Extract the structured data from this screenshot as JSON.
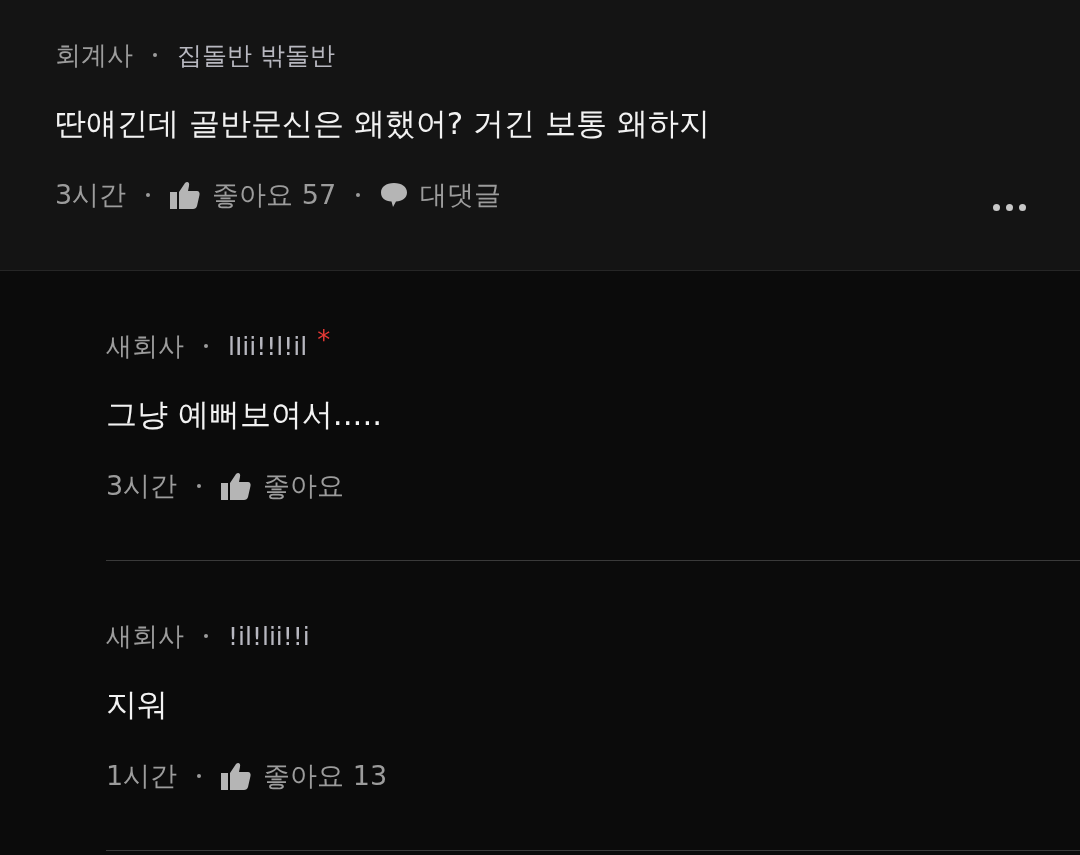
{
  "comment": {
    "company": "회계사",
    "nickname": "집돌반 밖돌반",
    "text": "딴얘긴데 골반문신은 왜했어? 거긴 보통 왜하지",
    "time": "3시간",
    "like_label": "좋아요",
    "like_count": "57",
    "reply_label": "대댓글"
  },
  "replies": [
    {
      "company": "새회사",
      "nickname": "lIii!!l!il",
      "mark": "*",
      "text": "그냥 예뻐보여서.....",
      "time": "3시간",
      "like_label": "좋아요"
    },
    {
      "company": "새회사",
      "nickname": "!il!lii!!i",
      "text": "지워",
      "time": "1시간",
      "like_label": "좋아요",
      "like_count": "13"
    }
  ]
}
